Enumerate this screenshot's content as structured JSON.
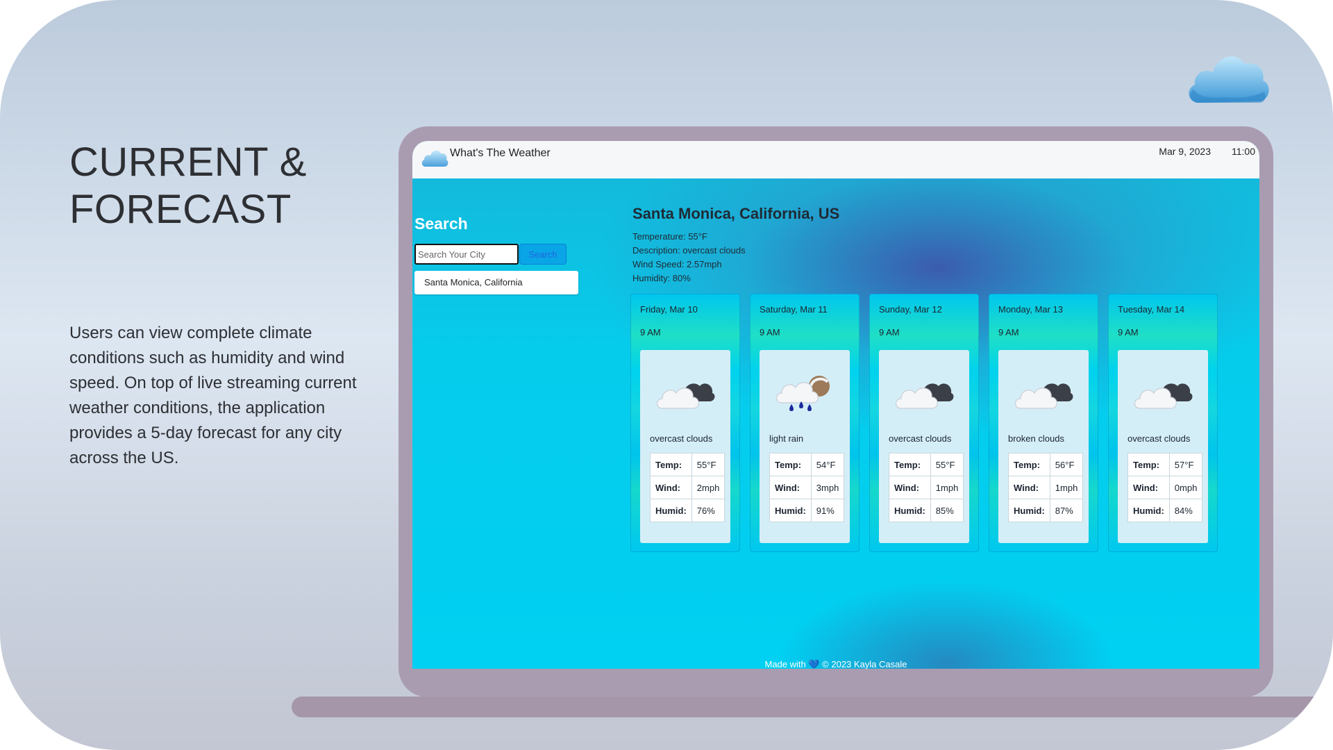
{
  "slide": {
    "heading": [
      "CURRENT &",
      "FORECAST"
    ],
    "description": "Users can view complete climate conditions such as humidity and wind speed. On top of live streaming current weather conditions, the application provides a 5-day forecast for any city across the US."
  },
  "app": {
    "title": "What's The Weather",
    "date": "Mar 9, 2023",
    "time": "11:00"
  },
  "search": {
    "title": "Search",
    "placeholder": "Search Your City",
    "button": "Search",
    "history": [
      "Santa Monica, California"
    ]
  },
  "current": {
    "city": "Santa Monica, California, US",
    "temperature": "Temperature: 55°F",
    "description": "Description: overcast clouds",
    "wind": "Wind Speed: 2.57mph",
    "humidity": "Humidity: 80%"
  },
  "forecast": [
    {
      "date": "Friday, Mar 10",
      "time": "9 AM",
      "icon": "overcast-clouds-icon",
      "desc": "overcast clouds",
      "temp_label": "Temp:",
      "temp": "55°F",
      "wind_label": "Wind:",
      "wind": "2mph",
      "humid_label": "Humid:",
      "humid": "76%"
    },
    {
      "date": "Saturday, Mar 11",
      "time": "9 AM",
      "icon": "light-rain-icon",
      "desc": "light rain",
      "temp_label": "Temp:",
      "temp": "54°F",
      "wind_label": "Wind:",
      "wind": "3mph",
      "humid_label": "Humid:",
      "humid": "91%"
    },
    {
      "date": "Sunday, Mar 12",
      "time": "9 AM",
      "icon": "overcast-clouds-icon",
      "desc": "overcast clouds",
      "temp_label": "Temp:",
      "temp": "55°F",
      "wind_label": "Wind:",
      "wind": "1mph",
      "humid_label": "Humid:",
      "humid": "85%"
    },
    {
      "date": "Monday, Mar 13",
      "time": "9 AM",
      "icon": "broken-clouds-icon",
      "desc": "broken clouds",
      "temp_label": "Temp:",
      "temp": "56°F",
      "wind_label": "Wind:",
      "wind": "1mph",
      "humid_label": "Humid:",
      "humid": "87%"
    },
    {
      "date": "Tuesday, Mar 14",
      "time": "9 AM",
      "icon": "overcast-clouds-icon",
      "desc": "overcast clouds",
      "temp_label": "Temp:",
      "temp": "57°F",
      "wind_label": "Wind:",
      "wind": "0mph",
      "humid_label": "Humid:",
      "humid": "84%"
    }
  ],
  "footer": {
    "made_with": "Made with",
    "heart": "💙",
    "credit": "© 2023 Kayla Casale"
  },
  "colors": {
    "accent": "#00d0f2",
    "card_inner": "#d4eef7",
    "laptop_frame": "#a99cb1"
  }
}
